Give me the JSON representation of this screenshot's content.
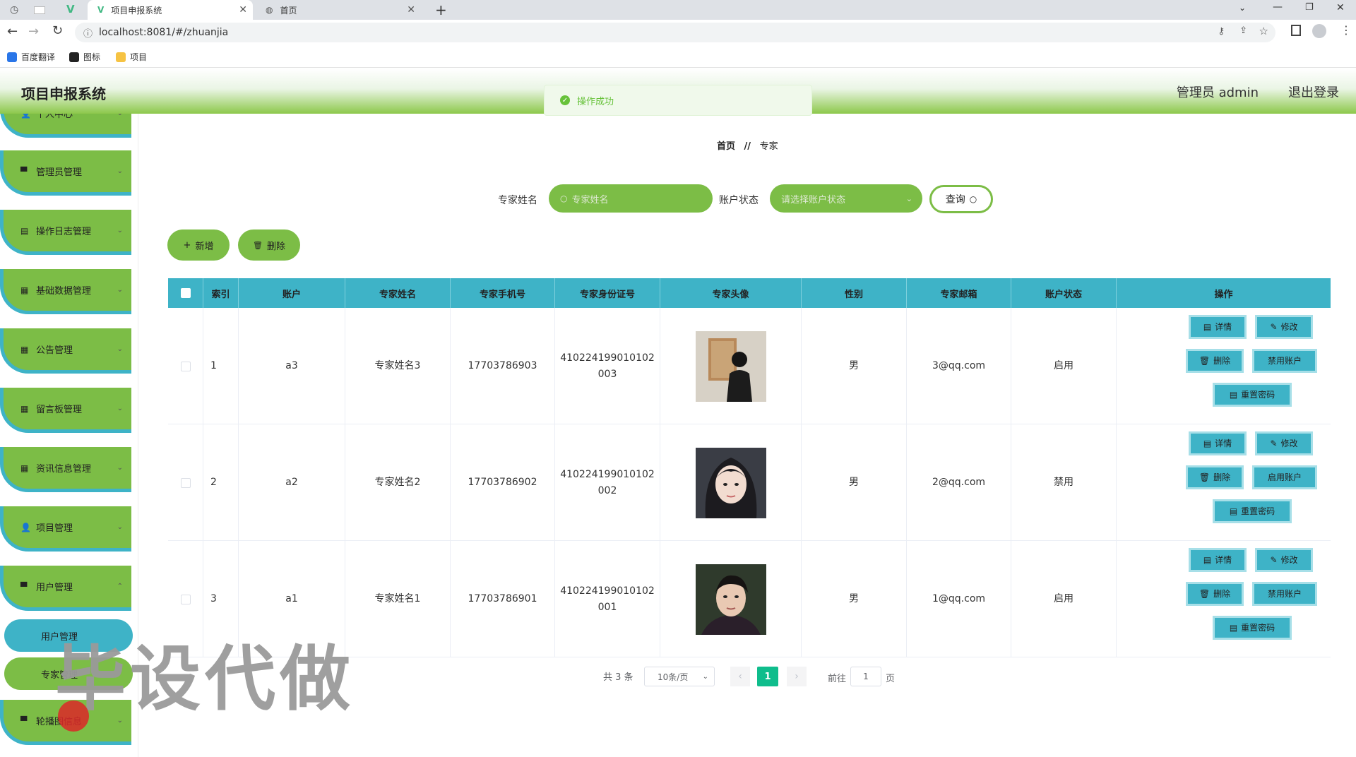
{
  "browser": {
    "tabs": [
      {
        "title": "项目申报系统",
        "active": true
      },
      {
        "title": "首页",
        "active": false
      }
    ],
    "url": "localhost:8081/#/zhuanjia",
    "bookmarks": [
      "百度翻译",
      "图标",
      "项目"
    ]
  },
  "header": {
    "title": "项目申报系统",
    "admin": "管理员 admin",
    "logout": "退出登录"
  },
  "toast": {
    "text": "操作成功"
  },
  "sidebar": {
    "items": [
      {
        "label": "个人中心"
      },
      {
        "label": "管理员管理"
      },
      {
        "label": "操作日志管理"
      },
      {
        "label": "基础数据管理"
      },
      {
        "label": "公告管理"
      },
      {
        "label": "留言板管理"
      },
      {
        "label": "资讯信息管理"
      },
      {
        "label": "项目管理"
      },
      {
        "label": "用户管理"
      },
      {
        "label": "轮播图信息"
      }
    ],
    "subitems": [
      {
        "label": "用户管理"
      },
      {
        "label": "专家管理"
      }
    ]
  },
  "watermark": "毕设代做",
  "breadcrumb": {
    "home": "首页",
    "sep": "//",
    "current": "专家"
  },
  "search": {
    "name_label": "专家姓名",
    "name_placeholder": "专家姓名",
    "status_label": "账户状态",
    "status_placeholder": "请选择账户状态",
    "query": "查询"
  },
  "actions": {
    "add": "新增",
    "delete": "删除"
  },
  "table": {
    "headers": [
      "索引",
      "账户",
      "专家姓名",
      "专家手机号",
      "专家身份证号",
      "专家头像",
      "性别",
      "专家邮箱",
      "账户状态",
      "操作"
    ],
    "rows": [
      {
        "index": "1",
        "account": "a3",
        "name": "专家姓名3",
        "phone": "17703786903",
        "id1": "410224199010102",
        "id2": "003",
        "gender": "男",
        "email": "3@qq.com",
        "status": "启用",
        "toggle": "禁用账户"
      },
      {
        "index": "2",
        "account": "a2",
        "name": "专家姓名2",
        "phone": "17703786902",
        "id1": "410224199010102",
        "id2": "002",
        "gender": "男",
        "email": "2@qq.com",
        "status": "禁用",
        "toggle": "启用账户"
      },
      {
        "index": "3",
        "account": "a1",
        "name": "专家姓名1",
        "phone": "17703786901",
        "id1": "410224199010102",
        "id2": "001",
        "gender": "男",
        "email": "1@qq.com",
        "status": "启用",
        "toggle": "禁用账户"
      }
    ],
    "row_buttons": {
      "detail": "详情",
      "edit": "修改",
      "delete": "删除",
      "reset": "重置密码"
    }
  },
  "pagination": {
    "total": "共 3 条",
    "page_size": "10条/页",
    "current": "1",
    "goto": "前往",
    "goto_value": "1",
    "page_unit": "页"
  }
}
